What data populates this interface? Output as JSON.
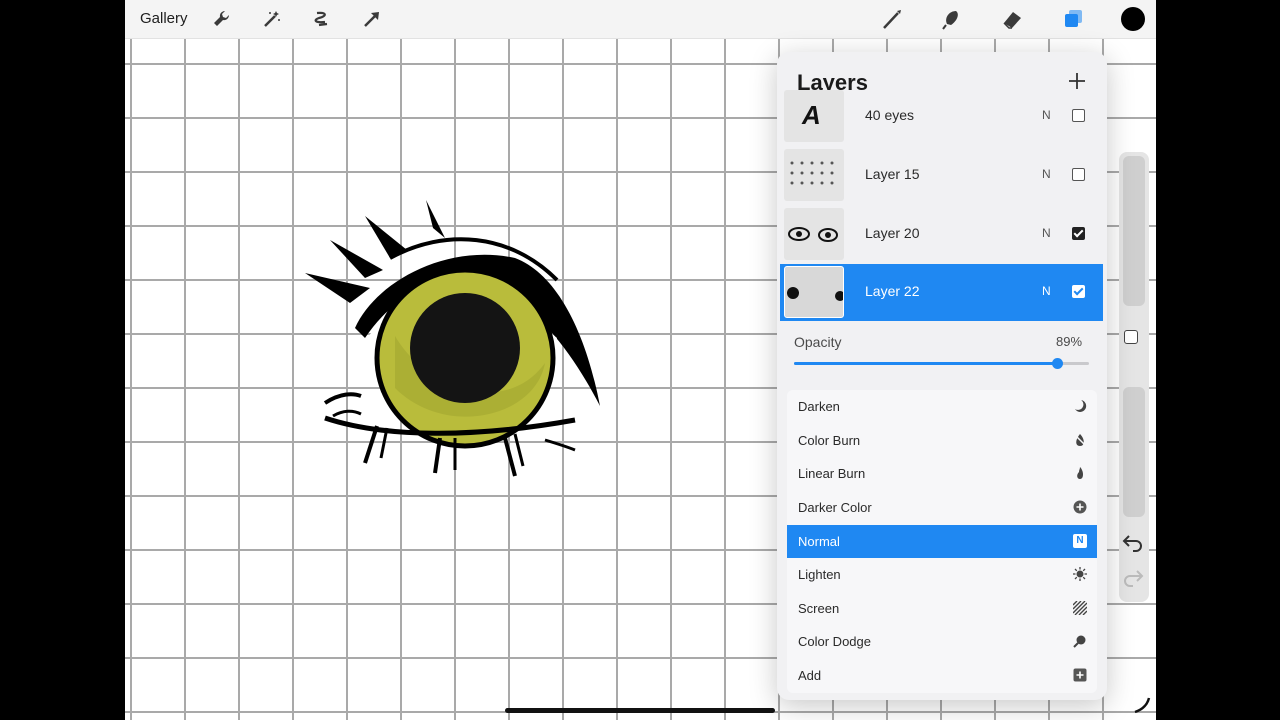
{
  "toolbar": {
    "gallery_label": "Gallery",
    "left_icons": [
      "wrench-icon",
      "magic-wand-icon",
      "selection-icon",
      "transform-arrow-icon"
    ],
    "right_icons": [
      "brush-icon",
      "smudge-icon",
      "eraser-icon",
      "layers-icon"
    ],
    "active_color": "#000000",
    "accent_color": "#1f88f2"
  },
  "layers_panel": {
    "title": "Layers",
    "layers": [
      {
        "name": "40 eyes",
        "mode": "N",
        "visible": false,
        "selected": false
      },
      {
        "name": "Layer 15",
        "mode": "N",
        "visible": false,
        "selected": false
      },
      {
        "name": "Layer 20",
        "mode": "N",
        "visible": true,
        "selected": false
      },
      {
        "name": "Layer 22",
        "mode": "N",
        "visible": true,
        "selected": true
      }
    ],
    "opacity_label": "Opacity",
    "opacity_value": "89%",
    "opacity_fraction": 0.89,
    "blend_modes": [
      {
        "label": "Darken",
        "icon": "moon-icon",
        "selected": false
      },
      {
        "label": "Color Burn",
        "icon": "flame-icon",
        "selected": false
      },
      {
        "label": "Linear Burn",
        "icon": "fire-icon",
        "selected": false
      },
      {
        "label": "Darker Color",
        "icon": "plus-circle-icon",
        "selected": false
      },
      {
        "label": "Normal",
        "icon": "normal-n-icon",
        "selected": true
      },
      {
        "label": "Lighten",
        "icon": "sun-icon",
        "selected": false
      },
      {
        "label": "Screen",
        "icon": "hatch-icon",
        "selected": false
      },
      {
        "label": "Color Dodge",
        "icon": "dodge-icon",
        "selected": false
      },
      {
        "label": "Add",
        "icon": "plus-square-icon",
        "selected": false
      }
    ],
    "normal_badge": "N"
  },
  "sidebar": {
    "icons": [
      "modify-square-icon",
      "undo-icon",
      "redo-icon"
    ]
  },
  "drawing": {
    "subject": "eye",
    "iris_color": "#b9bc3b",
    "pupil_color": "#141414"
  }
}
